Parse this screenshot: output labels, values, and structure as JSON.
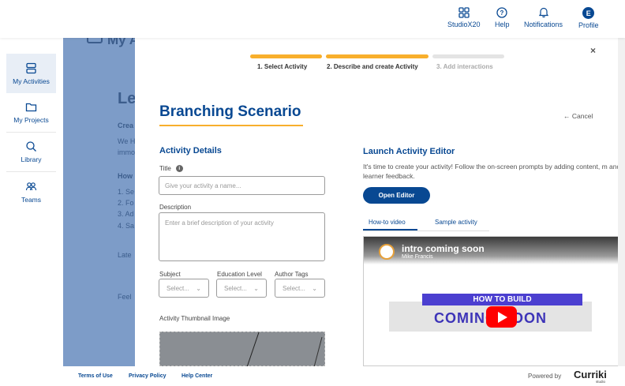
{
  "topbar": {
    "items": [
      {
        "label": "StudioX20",
        "icon": "grid-icon"
      },
      {
        "label": "Help",
        "icon": "help-icon"
      },
      {
        "label": "Notifications",
        "icon": "bell-icon"
      },
      {
        "label": "Profile",
        "icon": "avatar",
        "initial": "E"
      }
    ]
  },
  "sidebar": {
    "items": [
      {
        "label": "My Activities",
        "icon": "activities-icon",
        "active": true
      },
      {
        "label": "My Projects",
        "icon": "folder-icon"
      },
      {
        "label": "Library",
        "icon": "search-icon"
      },
      {
        "label": "Teams",
        "icon": "teams-icon"
      }
    ]
  },
  "background": {
    "heading": "My A",
    "title": "Le",
    "sub": "Crea",
    "p1": "We H",
    "p2": "immo",
    "how": "How",
    "list": [
      "1. Se",
      "2. Fo",
      "3. Ad",
      "4. Sa"
    ],
    "later": "Late",
    "feel": "Feel"
  },
  "modal": {
    "close": "×",
    "steps": [
      {
        "label": "1. Select Activity",
        "state": "done"
      },
      {
        "label": "2. Describe and create Activity",
        "state": "active"
      },
      {
        "label": "3. Add interactions",
        "state": "pending"
      }
    ],
    "title": "Branching Scenario",
    "cancel": "← Cancel",
    "details": {
      "heading": "Activity Details",
      "title_label": "Title",
      "title_placeholder": "Give your activity a name...",
      "description_label": "Description",
      "description_placeholder": "Enter a brief description of your activity",
      "subject_label": "Subject",
      "subject_value": "Select...",
      "education_label": "Education Level",
      "education_value": "Select...",
      "tags_label": "Author Tags",
      "tags_value": "Select...",
      "thumbnail_label": "Activity Thumbnail Image"
    },
    "launch": {
      "heading": "Launch Activity Editor",
      "description": "It's time to create your activity! Follow the on-screen prompts by adding content, m and learner feedback.",
      "button": "Open Editor",
      "tabs": [
        {
          "label": "How-to video",
          "active": true
        },
        {
          "label": "Sample activity",
          "active": false
        }
      ],
      "video": {
        "title": "intro coming soon",
        "author": "Mike Francis",
        "banner": "HOW TO BUILD",
        "coming": "COMING SOON"
      }
    }
  },
  "footer": {
    "links": [
      "Terms of Use",
      "Privacy Policy",
      "Help Center"
    ],
    "powered": "Powered by",
    "brand": "Curriki",
    "brand_sub": "studio"
  },
  "colors": {
    "primary": "#084892",
    "accent": "#f8af2c",
    "overlay": "#7d9cc8"
  }
}
